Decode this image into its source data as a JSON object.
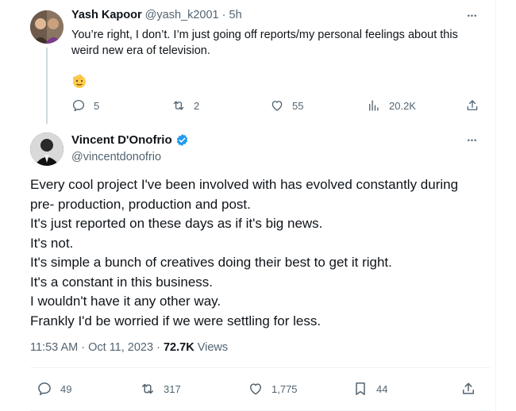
{
  "reply": {
    "name": "Yash Kapoor",
    "handle": "@yash_k2001",
    "separator": "·",
    "time": "5h",
    "text": "You’re right, I don’t. I’m just going off reports/my personal feelings about this weird new era of television.",
    "emoji": "saluting-face",
    "stats": {
      "replies": "5",
      "reposts": "2",
      "likes": "55",
      "views": "20.2K"
    }
  },
  "tweet": {
    "name": "Vincent D'Onofrio",
    "handle": "@vincentdonofrio",
    "verified_color": "#1d9bf0",
    "lines": [
      "Every cool project I've been involved with has evolved constantly during",
      "pre- production, production and post.",
      "It's just reported on these days as if it's big news.",
      "It's not.",
      "It's simple a bunch of creatives doing their best to get it right.",
      "It's a constant in this business.",
      "I wouldn't have it any other way.",
      "Frankly I'd be worried if we were settling for less."
    ],
    "time": "11:53 AM",
    "separator": "·",
    "date": "Oct 11, 2023",
    "views_count": "72.7K",
    "views_label": "Views",
    "stats": {
      "replies": "49",
      "reposts": "317",
      "likes": "1,775",
      "bookmarks": "44"
    }
  },
  "more_label": "•••",
  "colors": {
    "text": "#0f1419",
    "secondary": "#536471",
    "border": "#eff3f4",
    "accent": "#1d9bf0"
  }
}
